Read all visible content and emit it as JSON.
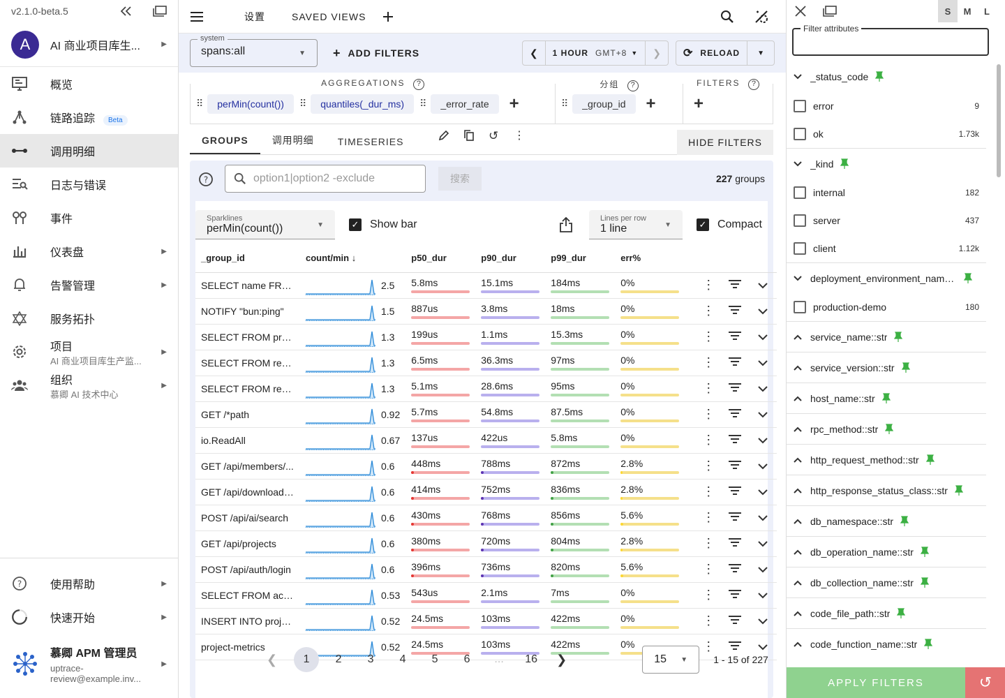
{
  "sidebar": {
    "version": "v2.1.0-beta.5",
    "project_initial": "A",
    "project_name": "AI 商业项目库生...",
    "nav": [
      {
        "label": "概览",
        "icon": "monitor-icon"
      },
      {
        "label": "链路追踪",
        "icon": "trace-icon",
        "badge": "Beta"
      },
      {
        "label": "调用明细",
        "icon": "span-icon",
        "active": true
      },
      {
        "label": "日志与错误",
        "icon": "logs-icon"
      },
      {
        "label": "事件",
        "icon": "events-icon"
      },
      {
        "label": "仪表盘",
        "icon": "dashboard-icon",
        "arrow": true
      },
      {
        "label": "告警管理",
        "icon": "bell-icon",
        "arrow": true
      },
      {
        "label": "服务拓扑",
        "icon": "topology-icon"
      },
      {
        "label": "项目",
        "sub": "AI 商业项目库生产监...",
        "icon": "gear-icon",
        "arrow": true
      },
      {
        "label": "组织",
        "sub": "慕卿 AI 技术中心",
        "icon": "people-icon",
        "arrow": true
      }
    ],
    "help_label": "使用帮助",
    "quickstart_label": "快速开始",
    "user_name": "慕卿 APM 管理员",
    "user_email1": "uptrace-",
    "user_email2": "review@example.inv..."
  },
  "topbar": {
    "settings": "设置",
    "saved_views": "SAVED VIEWS"
  },
  "filterbar": {
    "system_label": "system",
    "system_value": "spans:all",
    "add_filters": "ADD FILTERS",
    "period": "1 HOUR",
    "tz": "GMT+8",
    "reload": "RELOAD"
  },
  "agg": {
    "aggregations_title": "AGGREGATIONS",
    "groups_title": "分组",
    "filters_title": "FILTERS",
    "aggs": [
      "perMin(count())",
      "quantiles(_dur_ms)",
      "_error_rate"
    ],
    "group": "_group_id"
  },
  "tabs": [
    "GROUPS",
    "调用明细",
    "TIMESERIES"
  ],
  "hide_filters": "HIDE FILTERS",
  "search": {
    "placeholder": "option1|option2 -exclude",
    "button": "搜索",
    "count": "227",
    "count_suffix": "groups"
  },
  "options": {
    "sparklines_label": "Sparklines",
    "sparklines_value": "perMin(count())",
    "show_bar": "Show bar",
    "lines_label": "Lines per row",
    "lines_value": "1 line",
    "compact": "Compact"
  },
  "table": {
    "headers": [
      "_group_id",
      "count/min",
      "p50_dur",
      "p90_dur",
      "p99_dur",
      "err%"
    ],
    "rows": [
      {
        "name": "SELECT name FROM...",
        "rate": "2.5",
        "p50": "5.8ms",
        "p90": "15.1ms",
        "p99": "184ms",
        "err": "0%",
        "b50": 0,
        "b90": 0,
        "b99": 0,
        "be": 0
      },
      {
        "name": "NOTIFY \"bun:ping\"",
        "rate": "1.5",
        "p50": "887us",
        "p90": "3.8ms",
        "p99": "18ms",
        "err": "0%",
        "b50": 0,
        "b90": 0,
        "b99": 0,
        "be": 0
      },
      {
        "name": "SELECT FROM projec...",
        "rate": "1.3",
        "p50": "199us",
        "p90": "1.1ms",
        "p99": "15.3ms",
        "err": "0%",
        "b50": 0,
        "b90": 0,
        "b99": 0,
        "be": 0
      },
      {
        "name": "SELECT FROM replic...",
        "rate": "1.3",
        "p50": "6.5ms",
        "p90": "36.3ms",
        "p99": "97ms",
        "err": "0%",
        "b50": 0,
        "b90": 0,
        "b99": 0,
        "be": 0
      },
      {
        "name": "SELECT FROM replic...",
        "rate": "1.3",
        "p50": "5.1ms",
        "p90": "28.6ms",
        "p99": "95ms",
        "err": "0%",
        "b50": 0,
        "b90": 0,
        "b99": 0,
        "be": 0
      },
      {
        "name": "GET /*path",
        "rate": "0.92",
        "p50": "5.7ms",
        "p90": "54.8ms",
        "p99": "87.5ms",
        "err": "0%",
        "b50": 0,
        "b90": 0,
        "b99": 0,
        "be": 0
      },
      {
        "name": "io.ReadAll",
        "rate": "0.67",
        "p50": "137us",
        "p90": "422us",
        "p99": "5.8ms",
        "err": "0%",
        "b50": 0,
        "b90": 0,
        "b99": 0,
        "be": 0
      },
      {
        "name": "GET /api/members/...",
        "rate": "0.6",
        "p50": "448ms",
        "p90": "788ms",
        "p99": "872ms",
        "err": "2.8%",
        "b50": 0.05,
        "b90": 0.05,
        "b99": 0.05,
        "be": 0.03
      },
      {
        "name": "GET /api/downloads/...",
        "rate": "0.6",
        "p50": "414ms",
        "p90": "752ms",
        "p99": "836ms",
        "err": "2.8%",
        "b50": 0.05,
        "b90": 0.05,
        "b99": 0.05,
        "be": 0.03
      },
      {
        "name": "POST /api/ai/search",
        "rate": "0.6",
        "p50": "430ms",
        "p90": "768ms",
        "p99": "856ms",
        "err": "5.6%",
        "b50": 0.05,
        "b90": 0.05,
        "b99": 0.05,
        "be": 0.05
      },
      {
        "name": "GET /api/projects",
        "rate": "0.6",
        "p50": "380ms",
        "p90": "720ms",
        "p99": "804ms",
        "err": "2.8%",
        "b50": 0.05,
        "b90": 0.05,
        "b99": 0.05,
        "be": 0.03
      },
      {
        "name": "POST /api/auth/login",
        "rate": "0.6",
        "p50": "396ms",
        "p90": "736ms",
        "p99": "820ms",
        "err": "5.6%",
        "b50": 0.05,
        "b90": 0.05,
        "b99": 0.05,
        "be": 0.05
      },
      {
        "name": "SELECT FROM achiev...",
        "rate": "0.53",
        "p50": "543us",
        "p90": "2.1ms",
        "p99": "7ms",
        "err": "0%",
        "b50": 0,
        "b90": 0,
        "b99": 0,
        "be": 0
      },
      {
        "name": "INSERT INTO project_...",
        "rate": "0.52",
        "p50": "24.5ms",
        "p90": "103ms",
        "p99": "422ms",
        "err": "0%",
        "b50": 0,
        "b90": 0,
        "b99": 0,
        "be": 0
      },
      {
        "name": "project-metrics",
        "rate": "0.52",
        "p50": "24.5ms",
        "p90": "103ms",
        "p99": "422ms",
        "err": "0%",
        "b50": 0,
        "b90": 0,
        "b99": 0,
        "be": 0
      }
    ]
  },
  "pager": {
    "pages": [
      "1",
      "2",
      "3",
      "4",
      "5",
      "6",
      "...",
      "16"
    ],
    "per_page": "15",
    "range": "1 - 15 of 227"
  },
  "right": {
    "sizes": [
      "S",
      "M",
      "L"
    ],
    "filter_label": "Filter attributes",
    "apply": "APPLY FILTERS",
    "attrs": [
      {
        "name": "_status_code",
        "open": true,
        "values": [
          {
            "label": "error",
            "count": "9"
          },
          {
            "label": "ok",
            "count": "1.73k"
          }
        ]
      },
      {
        "name": "_kind",
        "open": true,
        "values": [
          {
            "label": "internal",
            "count": "182"
          },
          {
            "label": "server",
            "count": "437"
          },
          {
            "label": "client",
            "count": "1.12k"
          }
        ]
      },
      {
        "name": "deployment_environment_name...",
        "open": true,
        "values": [
          {
            "label": "production-demo",
            "count": "180"
          }
        ]
      },
      {
        "name": "service_name::str",
        "open": false,
        "values": []
      },
      {
        "name": "service_version::str",
        "open": false,
        "values": []
      },
      {
        "name": "host_name::str",
        "open": false,
        "values": []
      },
      {
        "name": "rpc_method::str",
        "open": false,
        "values": []
      },
      {
        "name": "http_request_method::str",
        "open": false,
        "values": []
      },
      {
        "name": "http_response_status_class::str",
        "open": false,
        "values": []
      },
      {
        "name": "db_namespace::str",
        "open": false,
        "values": []
      },
      {
        "name": "db_operation_name::str",
        "open": false,
        "values": []
      },
      {
        "name": "db_collection_name::str",
        "open": false,
        "values": []
      },
      {
        "name": "code_file_path::str",
        "open": false,
        "values": []
      },
      {
        "name": "code_function_name::str",
        "open": false,
        "values": []
      }
    ]
  },
  "colors": {
    "p50": "#f4a6a6",
    "p90": "#b9b0ee",
    "p99": "#b3dfb3",
    "err": "#f5e08a",
    "p50_fill": "#e53935",
    "p90_fill": "#5e35b1",
    "p99_fill": "#43a047",
    "err_fill": "#fdd835"
  }
}
